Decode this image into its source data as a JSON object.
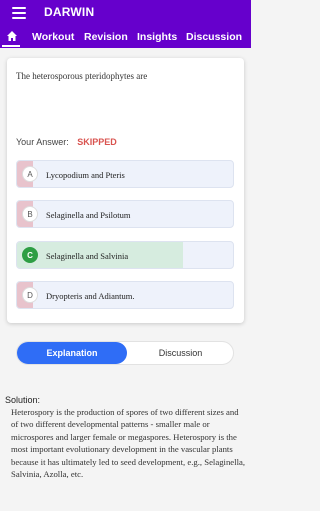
{
  "header": {
    "app_title": "DARWIN",
    "tabs": [
      {
        "label": "Workout"
      },
      {
        "label": "Revision"
      },
      {
        "label": "Insights"
      },
      {
        "label": "Discussion"
      }
    ]
  },
  "question": {
    "text": "The heterosporous pteridophytes are",
    "answer_label": "Your Answer:",
    "answer_value": "SKIPPED",
    "options": [
      {
        "letter": "A",
        "text": "Lycopodium and Pteris"
      },
      {
        "letter": "B",
        "text": "Selaginella and Psilotum"
      },
      {
        "letter": "C",
        "text": "Selaginella and Salvinia",
        "correct": true,
        "selected_share": 0.77
      },
      {
        "letter": "D",
        "text": "Dryopteris and Adiantum."
      }
    ]
  },
  "toggle": {
    "active": "Explanation",
    "inactive": "Discussion"
  },
  "solution": {
    "heading": "Solution:",
    "text": "Heterospory is the production of spores of two different sizes and of two different developmental patterns - smaller male or microspores and larger female or megaspores. Heterospory is the most important evolutionary development in the vascular plants because it has ultimately led to seed development, e.g., Selaginella, Salvinia, Azolla, etc."
  },
  "colors": {
    "header": "#6600cc",
    "skipped": "#d9534f",
    "correct": "#2e9e44",
    "toggle_active": "#2f6df6"
  }
}
